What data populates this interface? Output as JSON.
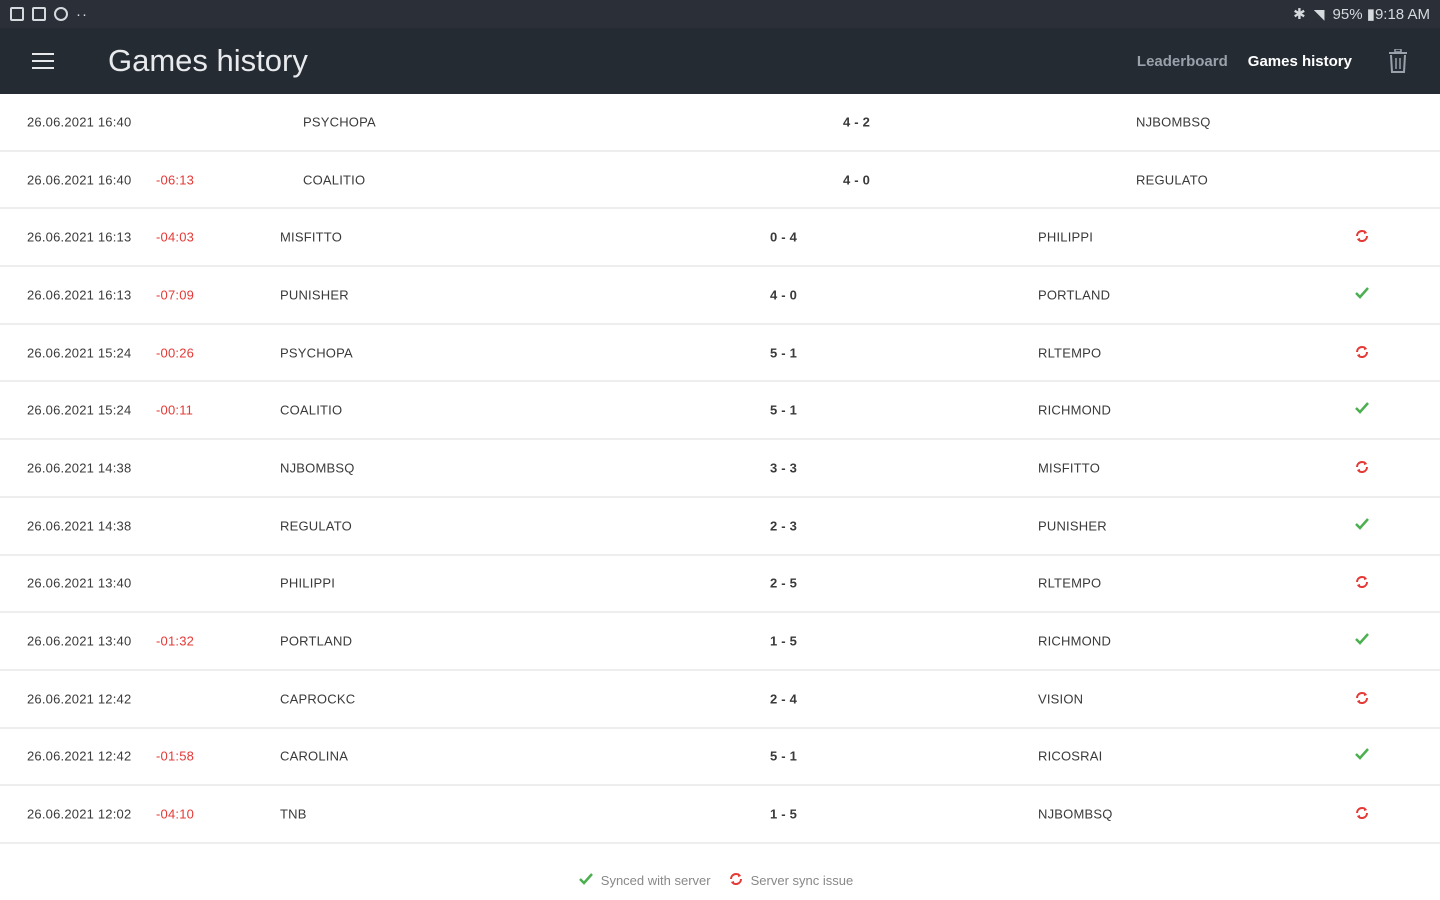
{
  "status_bar": {
    "right_text": "95% ▮9:18 AM",
    "left_icons": [
      "image-icon",
      "sim-icon",
      "at-icon"
    ],
    "overflow": "··"
  },
  "header": {
    "menu_icon": "hamburger-menu-icon",
    "title": "Games history",
    "nav": [
      {
        "label": "Leaderboard",
        "active": false
      },
      {
        "label": "Games history",
        "active": true
      }
    ],
    "delete_icon": "trash-icon"
  },
  "colors": {
    "appbar": "#252b33",
    "statusbar": "#2a2f38",
    "duration": "#e53935",
    "synced": "#4caf50",
    "sync_issue": "#e53935"
  },
  "games": [
    {
      "date": "26.06.2021 16:40",
      "duration": "",
      "home": "PSYCHOPA",
      "score": "4 - 2",
      "away": "NJBOMBSQ",
      "status": ""
    },
    {
      "date": "26.06.2021 16:40",
      "duration": "-06:13",
      "home": "COALITIO",
      "score": "4 - 0",
      "away": "REGULATO",
      "status": ""
    },
    {
      "date": "26.06.2021 16:13",
      "duration": "-04:03",
      "home": "MISFITTO",
      "score": "0 - 4",
      "away": "PHILIPPI",
      "status": "issue"
    },
    {
      "date": "26.06.2021 16:13",
      "duration": "-07:09",
      "home": "PUNISHER",
      "score": "4 - 0",
      "away": "PORTLAND",
      "status": "synced"
    },
    {
      "date": "26.06.2021 15:24",
      "duration": "-00:26",
      "home": "PSYCHOPA",
      "score": "5 - 1",
      "away": "RLTEMPO",
      "status": "issue"
    },
    {
      "date": "26.06.2021 15:24",
      "duration": "-00:11",
      "home": "COALITIO",
      "score": "5 - 1",
      "away": "RICHMOND",
      "status": "synced"
    },
    {
      "date": "26.06.2021 14:38",
      "duration": "",
      "home": "NJBOMBSQ",
      "score": "3 - 3",
      "away": "MISFITTO",
      "status": "issue"
    },
    {
      "date": "26.06.2021 14:38",
      "duration": "",
      "home": "REGULATO",
      "score": "2 - 3",
      "away": "PUNISHER",
      "status": "synced"
    },
    {
      "date": "26.06.2021 13:40",
      "duration": "",
      "home": "PHILIPPI",
      "score": "2 - 5",
      "away": "RLTEMPO",
      "status": "issue"
    },
    {
      "date": "26.06.2021 13:40",
      "duration": "-01:32",
      "home": "PORTLAND",
      "score": "1 - 5",
      "away": "RICHMOND",
      "status": "synced"
    },
    {
      "date": "26.06.2021 12:42",
      "duration": "",
      "home": "CAPROCKC",
      "score": "2 - 4",
      "away": "VISION",
      "status": "issue"
    },
    {
      "date": "26.06.2021 12:42",
      "duration": "-01:58",
      "home": "CAROLINA",
      "score": "5 - 1",
      "away": "RICOSRAI",
      "status": "synced"
    },
    {
      "date": "26.06.2021 12:02",
      "duration": "-04:10",
      "home": "TNB",
      "score": "1 - 5",
      "away": "NJBOMBSQ",
      "status": "issue"
    }
  ],
  "legend": {
    "synced_label": "Synced with server",
    "issue_label": "Server sync issue"
  }
}
